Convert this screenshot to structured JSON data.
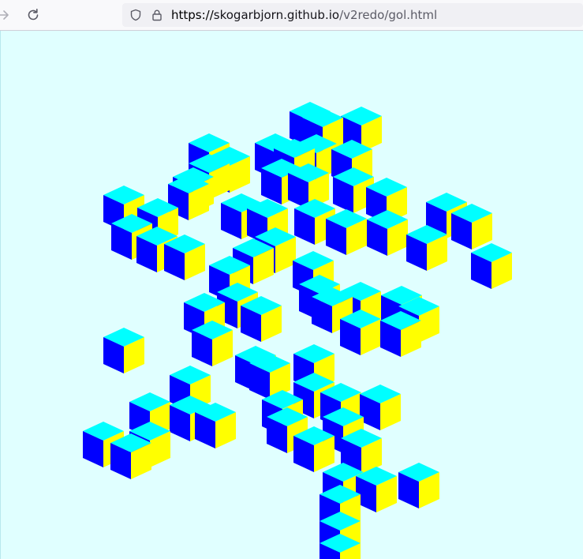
{
  "browser": {
    "url_protocol": "https://",
    "url_host": "skogarbjorn.github.io",
    "url_path": "/v2redo/gol.html"
  },
  "colors": {
    "viewport_bg": "#e0ffff",
    "cube_top": "#00ffff",
    "cube_left": "#0000ff",
    "cube_right": "#ffff00"
  },
  "icons": {
    "back": "arrow-right-icon",
    "reload": "reload-icon",
    "tracking": "shield-icon",
    "secure": "lock-icon"
  },
  "cells": [
    [
      264,
      181
    ],
    [
      290,
      198
    ],
    [
      264,
      207
    ],
    [
      244,
      224
    ],
    [
      238,
      233
    ],
    [
      392,
      141
    ],
    [
      408,
      149
    ],
    [
      457,
      147
    ],
    [
      348,
      181
    ],
    [
      372,
      188
    ],
    [
      400,
      182
    ],
    [
      445,
      189
    ],
    [
      356,
      213
    ],
    [
      390,
      219
    ],
    [
      447,
      224
    ],
    [
      489,
      237
    ],
    [
      156,
      247
    ],
    [
      199,
      263
    ],
    [
      305,
      257
    ],
    [
      338,
      264
    ],
    [
      398,
      264
    ],
    [
      438,
      277
    ],
    [
      490,
      278
    ],
    [
      565,
      256
    ],
    [
      597,
      270
    ],
    [
      540,
      297
    ],
    [
      166,
      283
    ],
    [
      198,
      299
    ],
    [
      233,
      309
    ],
    [
      320,
      314
    ],
    [
      348,
      300
    ],
    [
      622,
      320
    ],
    [
      290,
      336
    ],
    [
      396,
      330
    ],
    [
      404,
      360
    ],
    [
      420,
      376
    ],
    [
      456,
      369
    ],
    [
      508,
      374
    ],
    [
      530,
      388
    ],
    [
      507,
      406
    ],
    [
      258,
      383
    ],
    [
      300,
      370
    ],
    [
      330,
      387
    ],
    [
      268,
      418
    ],
    [
      156,
      427
    ],
    [
      323,
      450
    ],
    [
      341,
      460
    ],
    [
      456,
      404
    ],
    [
      240,
      475
    ],
    [
      397,
      448
    ],
    [
      397,
      484
    ],
    [
      431,
      497
    ],
    [
      481,
      499
    ],
    [
      189,
      509
    ],
    [
      240,
      513
    ],
    [
      272,
      522
    ],
    [
      357,
      506
    ],
    [
      363,
      528
    ],
    [
      434,
      528
    ],
    [
      457,
      555
    ],
    [
      130,
      546
    ],
    [
      165,
      561
    ],
    [
      189,
      546
    ],
    [
      397,
      552
    ],
    [
      434,
      598
    ],
    [
      476,
      603
    ],
    [
      530,
      598
    ],
    [
      430,
      626
    ],
    [
      430,
      660
    ],
    [
      430,
      688
    ]
  ]
}
